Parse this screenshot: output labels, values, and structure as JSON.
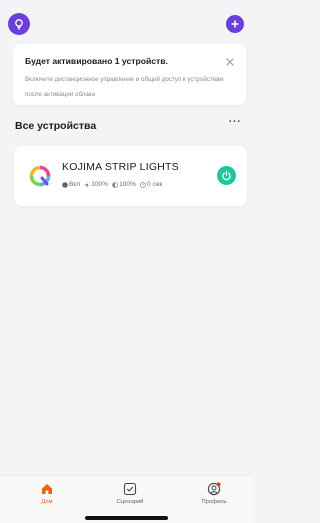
{
  "colors": {
    "accent": "#6a3fd9",
    "tab_active": "#f0601c",
    "power_on": "#1fc69b",
    "notification_dot": "#e43b2c"
  },
  "header": {
    "left_icon": "light-bulb-icon",
    "right_icon": "plus-circle-icon"
  },
  "banner": {
    "title": "Будет активировано 1 устройств.",
    "description": "Включите дистанционное управление и общий доступ к устройствам после активации облака",
    "close_icon": "close-icon"
  },
  "devices_section": {
    "title": "Все устройства",
    "more_label": "···"
  },
  "device": {
    "name": "KOJIMA STRIP LIGHTS",
    "status": {
      "power": "Вкл",
      "brightness": "100%",
      "saturation": "100%",
      "timer": "0 сек"
    },
    "power_icon": "power-icon"
  },
  "tabs": [
    {
      "label": "Дом",
      "icon": "house-icon",
      "active": true
    },
    {
      "label": "Сценарий",
      "icon": "checkbox-icon",
      "active": false
    },
    {
      "label": "Профиль",
      "icon": "user-icon",
      "active": false
    }
  ]
}
